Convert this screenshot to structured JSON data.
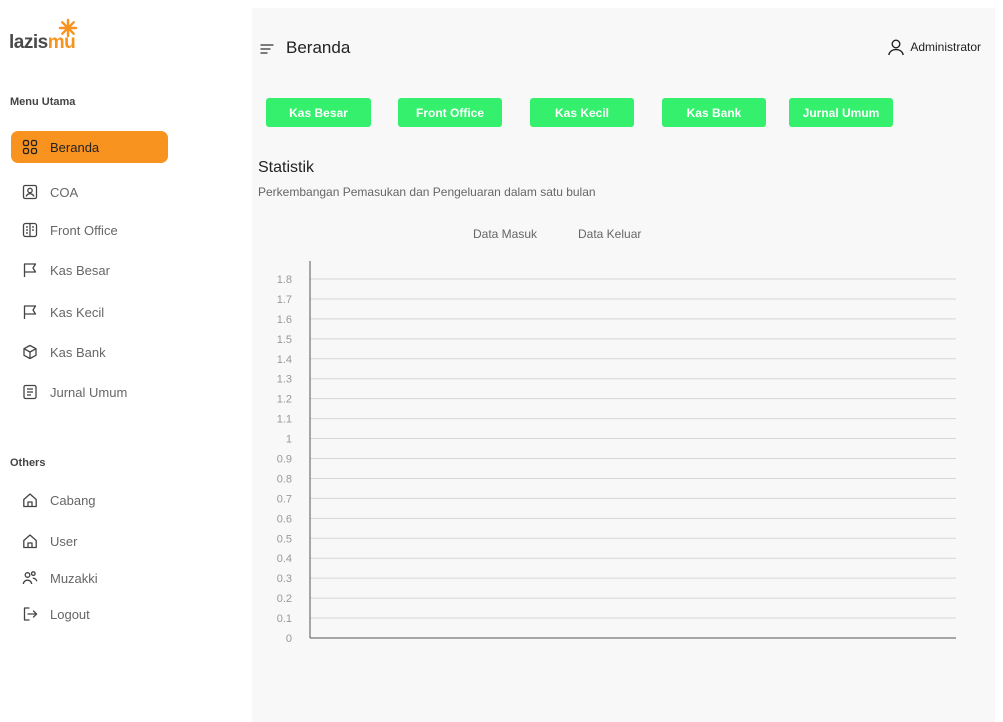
{
  "brand": {
    "logo_text_a": "lazis",
    "logo_text_b": "mu",
    "accent": "#f7931e"
  },
  "sidebar": {
    "menu_title": "Menu Utama",
    "items": [
      {
        "label": "Beranda",
        "icon": "grid-icon",
        "active": true
      },
      {
        "label": "COA",
        "icon": "contact-card-icon"
      },
      {
        "label": "Front Office",
        "icon": "building-icon"
      },
      {
        "label": "Kas Besar",
        "icon": "flag-icon"
      },
      {
        "label": "Kas Kecil",
        "icon": "flag-icon"
      },
      {
        "label": "Kas Bank",
        "icon": "box-icon"
      },
      {
        "label": "Jurnal Umum",
        "icon": "document-icon"
      }
    ],
    "others_title": "Others",
    "others": [
      {
        "label": "Cabang",
        "icon": "home-icon"
      },
      {
        "label": "User",
        "icon": "home-icon"
      },
      {
        "label": "Muzakki",
        "icon": "users-icon"
      },
      {
        "label": "Logout",
        "icon": "logout-icon"
      }
    ]
  },
  "header": {
    "title": "Beranda",
    "user": "Administrator"
  },
  "quick_actions": [
    "Kas Besar",
    "Front Office",
    "Kas Kecil",
    "Kas Bank",
    "Jurnal Umum"
  ],
  "quick_action_color": "#34f06d",
  "statistik": {
    "title": "Statistik",
    "subtitle": "Perkembangan Pemasukan dan Pengeluaran dalam satu bulan"
  },
  "chart_data": {
    "type": "line",
    "title": "",
    "xlabel": "",
    "ylabel": "",
    "series": [
      {
        "name": "Data Masuk",
        "values": []
      },
      {
        "name": "Data Keluar",
        "values": []
      }
    ],
    "ylim": [
      0,
      1.8
    ],
    "y_ticks": [
      "0",
      "0.1",
      "0.2",
      "0.3",
      "0.4",
      "0.5",
      "0.6",
      "0.7",
      "0.8",
      "0.9",
      "1",
      "1.1",
      "1.2",
      "1.3",
      "1.4",
      "1.5",
      "1.6",
      "1.7",
      "1.8"
    ],
    "grid": true,
    "legend": "top-center"
  }
}
